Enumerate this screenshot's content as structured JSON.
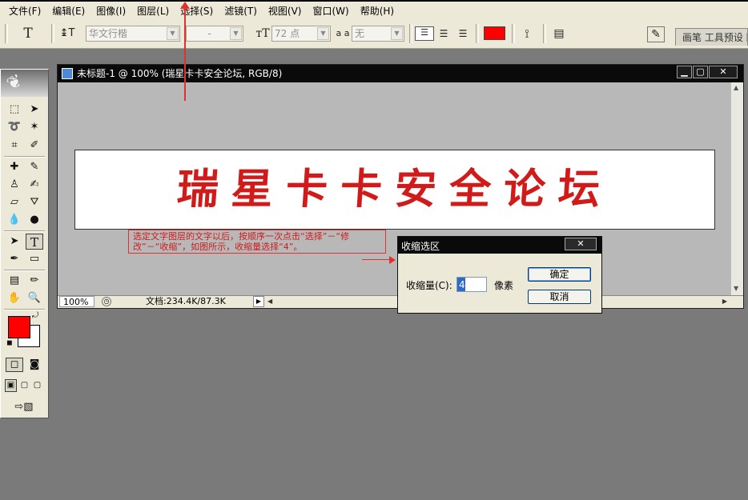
{
  "menu": [
    "文件(F)",
    "编辑(E)",
    "图像(I)",
    "图层(L)",
    "选择(S)",
    "滤镜(T)",
    "视图(V)",
    "窗口(W)",
    "帮助(H)"
  ],
  "options": {
    "tool_glyph": "T",
    "font_family": "华文行楷",
    "font_style": "-",
    "font_size": "72 点",
    "aa_label": "a a",
    "antialias": "无",
    "color": "#ff0000",
    "palette_tab": "画笔 工具预设 图层复合"
  },
  "document": {
    "title": "未标题-1 @ 100% (瑞星卡卡安全论坛, RGB/8)",
    "canvas_text": "瑞星卡卡安全论坛",
    "zoom": "100%",
    "doc_size": "文档:234.4K/87.3K"
  },
  "toolbox": {
    "foreground_color": "#ff0000",
    "background_color": "#ffffff"
  },
  "annotation": "选定文字图层的文字以后，按顺序一次点击“选择”－“修改”－“收缩”，如图所示，收缩量选择“4”。",
  "dialog": {
    "title": "收缩选区",
    "label": "收缩量(C):",
    "value": "4",
    "unit": "像素",
    "ok": "确定",
    "cancel": "取消"
  }
}
